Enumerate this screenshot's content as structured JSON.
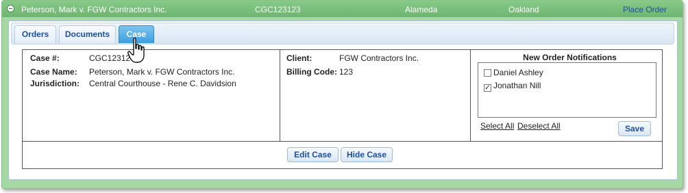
{
  "header": {
    "case_title": "Peterson, Mark v. FGW Contractors Inc.",
    "case_number": "CGC123123",
    "county": "Alameda",
    "city": "Oakland",
    "place_order": "Place Order"
  },
  "tabs": [
    {
      "label": "Orders"
    },
    {
      "label": "Documents"
    },
    {
      "label": "Case",
      "active": true
    }
  ],
  "case": {
    "case_number_label": "Case #:",
    "case_number_value": "CGC12312",
    "case_name_label": "Case Name:",
    "case_name_value": "Peterson, Mark v. FGW Contractors Inc.",
    "jurisdiction_label": "Jurisdiction:",
    "jurisdiction_value": "Central Courthouse - Rene C. Davidsion",
    "client_label": "Client:",
    "client_value": "FGW Contractors Inc.",
    "billing_code_label": "Billing Code:",
    "billing_code_value": "123"
  },
  "notifications": {
    "title": "New Order Notifications",
    "users": [
      {
        "name": "Daniel Ashley",
        "checked": false
      },
      {
        "name": "Jonathan Nill",
        "checked": true
      }
    ],
    "select_all": "Select All",
    "deselect_all": "Deselect All",
    "save": "Save"
  },
  "actions": {
    "edit_case": "Edit Case",
    "hide_case": "Hide Case"
  },
  "colors": {
    "panel_green": "#a6d8a3",
    "header_green": "#6fb572",
    "link_blue": "#1e4f9c",
    "active_tab_blue": "#3a9fe0"
  }
}
